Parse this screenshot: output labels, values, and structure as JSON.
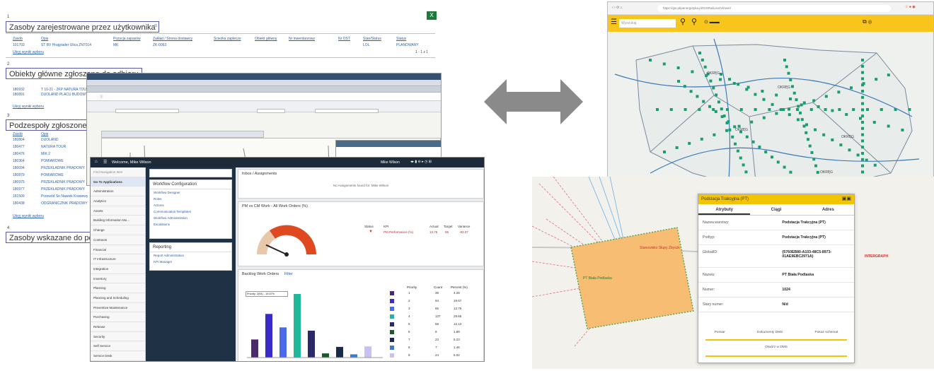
{
  "report": {
    "sections": [
      {
        "num": "1",
        "title": "Zasoby zarejestrowane przez użytkownika"
      },
      {
        "num": "2",
        "title": "Obiekty główne zgłoszone do odbioru"
      },
      {
        "num": "3",
        "title": "Podzespoły zgłoszone do odbioru"
      },
      {
        "num": "4",
        "title": "Zasoby wskazane do poprawy"
      }
    ],
    "s1_headers": [
      "Zasób",
      "Opis",
      "Pozycja zapasów",
      "Zakład / Strona dostawcy",
      "Ścieżka zaplecze",
      "Obiekt główny",
      "Nr inwentarzowy",
      "Nr OST",
      "Stan/Status",
      "Status"
    ],
    "s1_row": [
      "101703",
      "ST BV Hrajgrader Ulica ZN7014",
      "MK",
      "ZK-0063",
      "",
      "",
      "",
      "",
      "LOL",
      "PLANOWANY"
    ],
    "s2_rows": [
      [
        "180932",
        "T 10-21 - 2KP NATURA TOUR"
      ],
      [
        "180891",
        "DUOLAND PLACU BUDOWY"
      ]
    ],
    "s3_headers": [
      "Zasób",
      "Opis"
    ],
    "s3_rows": [
      [
        "180804",
        "DUOLAND"
      ],
      [
        "180477",
        "NATURA TOUR"
      ],
      [
        "180476",
        "MIK 2"
      ],
      [
        "180364",
        "POMIAROWE"
      ],
      [
        "180094",
        "PRZEKŁADNIK PRĄDOWY"
      ],
      [
        "180879",
        "POMIAROWE"
      ],
      [
        "180975",
        "PRZEKŁADNIK PRĄDOWY"
      ],
      [
        "180977",
        "PRZEKŁADNIK PRĄDOWY"
      ],
      [
        "181509",
        "Przewód Sn Nawiek Krawewy"
      ],
      [
        "180438",
        "ODGRANICZNIK PRĄDOWY"
      ]
    ],
    "more_link": "Ukryj wyniki wyboru",
    "total": "1 - 1 z 1",
    "export_icon": "excel-icon"
  },
  "front": {
    "top_title": "Welcome, Mike Wilson",
    "top_user": "Mike Wilson",
    "side_search": "Find Navigation Item",
    "side_items": [
      "Go To Applications",
      "Administration",
      "Analytics",
      "Assets",
      "Building Information Mo...",
      "Change",
      "Contracts",
      "Financial",
      "IT Infrastructure",
      "Integration",
      "Inventory",
      "Planning",
      "Planning and Scheduling",
      "Preventive Maintenance",
      "Purchasing",
      "Release",
      "Security",
      "Self Service",
      "Service Desk"
    ],
    "wf_title": "Workflow Configuration",
    "wf_links": [
      "Workflow Designer",
      "Roles",
      "Actions",
      "Communication Templates",
      "Workflow Administration",
      "Escalations"
    ],
    "rep_title": "Reporting",
    "rep_links": [
      "Report Administration",
      "KPI Manager"
    ],
    "inbox_title": "Inbox / Assignments",
    "inbox_msg": "No Assignments found for: Mike Wilson",
    "kpi_title": "PM vs CM Work - All Work Orders (%)",
    "kpi_cols": [
      "Status",
      "KPI",
      "Actual",
      "Target",
      "Variance"
    ],
    "kpi_row": [
      "PM Performance (%)",
      "13.75",
      "95",
      "-83.07"
    ],
    "bwo_title": "Backlog Work Orders",
    "bwo_filter": "Filter",
    "bwo_cols": [
      "Priority",
      "Count",
      "Percent (%)"
    ],
    "bwo_rows": [
      [
        "1",
        "39",
        "4.28"
      ],
      [
        "2",
        "94",
        "19.67"
      ],
      [
        "3",
        "65",
        "13.75"
      ],
      [
        "4",
        "137",
        "29.66"
      ],
      [
        "5",
        "58",
        "12.13"
      ],
      [
        "6",
        "9",
        "1.88"
      ],
      [
        "7",
        "23",
        "5.23"
      ],
      [
        "8",
        "7",
        "1.46"
      ],
      [
        "9",
        "24",
        "5.02"
      ]
    ],
    "bwo_tooltip": "Priority: 2(94) - 19.67%"
  },
  "chart_data": {
    "type": "bar",
    "title": "Backlog Work Orders",
    "categories": [
      "1",
      "2",
      "3",
      "4",
      "5",
      "6",
      "7",
      "8",
      "9"
    ],
    "values": [
      39,
      94,
      65,
      137,
      58,
      9,
      23,
      7,
      24
    ],
    "colors": [
      "#4a2a6a",
      "#3a2ac8",
      "#4a6ae8",
      "#1fb89a",
      "#2a2a6a",
      "#1a5a2a",
      "#1a2a4a",
      "#3a7ac8",
      "#c8c0f0"
    ]
  },
  "kpi_gauge": {
    "actual": 13.75,
    "target": 95
  },
  "map": {
    "url": "https://gis.pkpenergetyka.pl/GISRailLine/Viewer/",
    "search_placeholder": "Wyszukaj",
    "accent": "#f8c51c",
    "marker_color": "#1a9e6e",
    "labels": [
      "OKRĘG",
      "OKRĘG",
      "OKRĘG",
      "OKRĘG",
      "OKRĘG"
    ]
  },
  "popup": {
    "title": "Podstacja Trakcyjna (PT)",
    "tabs": [
      "Atrybuty",
      "Ciągi",
      "Adres"
    ],
    "rows": [
      [
        "Nazwa warstwy:",
        "Podstacja Trakcyjna (PT)"
      ],
      [
        "Podtyp:",
        "Podstacja Trakcyjna (PT)"
      ],
      [
        "GlobalID:",
        "{5760EB80-A103-48C5-8973-01AE9EBC2971A}"
      ],
      [
        "Nazwa:",
        "PT Biała Podlaska"
      ],
      [
        "Numer:",
        "1024"
      ],
      [
        "Stary numer:",
        "N/d"
      ]
    ],
    "foot1": [
      "Pomiar",
      "Dokumenty DMS",
      "Pokaż schemat"
    ],
    "foot2": "Otwórz w DMS",
    "area_label1": "PT Biała Podlaska",
    "area_label2": "Stanowisko Słupy Zbyszk",
    "brand": "INTERGRAPH"
  }
}
